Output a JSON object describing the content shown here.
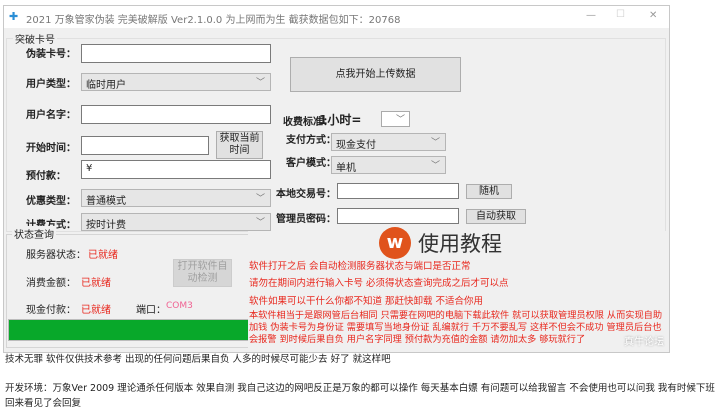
{
  "window": {
    "title": "2021 万象管家伪装 完美破解版   Ver2.1.0.0 为上网而为生    截获数据包如下：20768",
    "minimize": "—",
    "maximize": "☐",
    "close": "✕"
  },
  "card_group": {
    "title": "突破卡号",
    "fake_card_label": "伪装卡号：",
    "fake_card_value": "",
    "user_type_label": "用户类型：",
    "user_type_value": "临时用户",
    "user_name_label": "用户名字：",
    "user_name_value": "",
    "start_time_label": "开始时间：",
    "start_time_value": "",
    "get_time_button": "获取当前时间",
    "prepay_label": "预付款：",
    "prepay_value": "¥",
    "discount_label": "优惠类型：",
    "discount_value": "普通模式",
    "billing_label": "计费方式：",
    "billing_value": "按时计费",
    "fee_label": "收费标准：",
    "fee_unit": "1小时=",
    "fee_value": "",
    "pay_method_label": "支付方式：",
    "pay_method_value": "现金支付",
    "client_mode_label": "客户模式：",
    "client_mode_value": "单机",
    "trade_no_label": "本地交易号：",
    "trade_no_value": "",
    "random_button": "随机",
    "admin_pwd_label": "管理员密码：",
    "admin_pwd_value": "",
    "auto_get_button": "自动获取",
    "upload_button": "点我开始上传数据"
  },
  "status_group": {
    "title": "状态查询",
    "server_label": "服务器状态：",
    "server_value": "已就绪",
    "amount_label": "消费金额：",
    "amount_value": "已就绪",
    "cash_label": "现金付款：",
    "cash_value": "已就绪",
    "port_label": "端口：",
    "port_value": "COM3",
    "auto_detect_button": "打开软件自动检测",
    "progress": 100
  },
  "tutorial": {
    "title": "使用教程",
    "lines": [
      "软件打开之后 会自动检测服务器状态与端口是否正常",
      "请勿在期间内进行输入卡号 必须得状态查询完成之后才可以点",
      "软件如果可以干什么你都不知道 那赶快卸载 不适合你用",
      "本软件相当于是跟网管后台相同 只需要在网吧的电脑下载此软件 就可以获取管理员权限 从而实现自助加钱 伪装卡号为身份证 需要填写当地身份证 乱编就行 千万不要乱写 这样不但会不成功 管理员后台也会报警 到时候后果自负 用户名字同理 预付款为充值的金额 请勿加太多 够玩就行了"
    ],
    "watermark": "真牛论坛"
  },
  "page_text": [
    "技术无罪 软件仅供技术参考 出现的任何问题后果自负 人多的时候尽可能少去 好了 就这样吧",
    "开发环境：万象Ver 2009 理论通杀任何版本 效果自测 我自己这边的网吧反正是万象的都可以操作 每天基本白嫖 有问题可以给我留言 不会使用也可以问我 我有时候下班回来看见了会回复"
  ],
  "colors": {
    "progress": "#08a82a",
    "status": "#e8281e",
    "port": "#f06292",
    "logo": "#e0531c"
  }
}
